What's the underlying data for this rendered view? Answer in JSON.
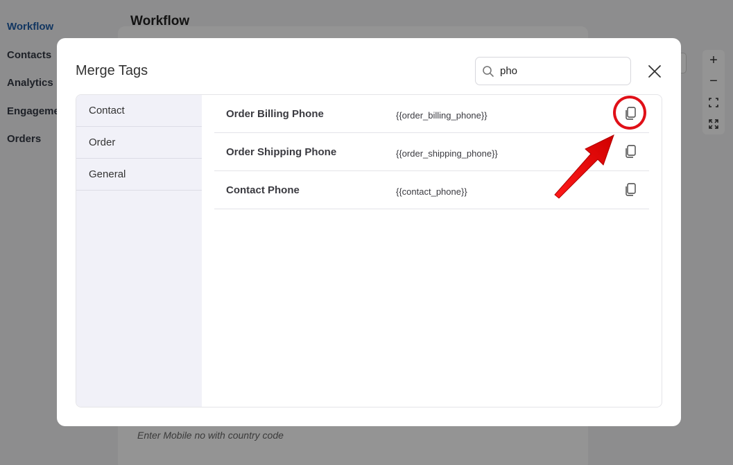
{
  "background": {
    "sidebar": [
      {
        "label": "Workflow",
        "active": true
      },
      {
        "label": "Contacts"
      },
      {
        "label": "Analytics"
      },
      {
        "label": "Engagement"
      },
      {
        "label": "Orders"
      }
    ],
    "page_title": "Workflow",
    "mobile_hint": "Enter Mobile no with country code",
    "zoom_controls": [
      "plus-icon",
      "minus-icon",
      "fit-icon",
      "fullscreen-icon"
    ]
  },
  "modal": {
    "title": "Merge Tags",
    "search": {
      "value": "pho",
      "placeholder": ""
    },
    "close_icon": "close-icon",
    "categories": [
      "Contact",
      "Order",
      "General"
    ],
    "tags": [
      {
        "label": "Order Billing Phone",
        "code": "{{order_billing_phone}}"
      },
      {
        "label": "Order Shipping Phone",
        "code": "{{order_shipping_phone}}"
      },
      {
        "label": "Contact Phone",
        "code": "{{contact_phone}}"
      }
    ]
  },
  "colors": {
    "accent_nav": "#1f5ea8",
    "annotation_red": "#e01018",
    "category_bg": "#f1f1f8"
  }
}
